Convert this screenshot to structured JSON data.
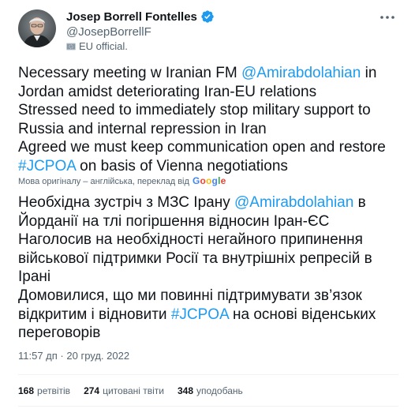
{
  "author": {
    "display_name": "Josep Borrell Fontelles",
    "handle": "@JosepBorrellF",
    "affiliation": "EU official."
  },
  "tweet": {
    "original_lines": [
      [
        {
          "t": "Necessary meeting w Iranian FM "
        },
        {
          "t": "@Amirabdolahian",
          "link": true
        },
        {
          "t": " in"
        }
      ],
      [
        {
          "t": "Jordan amidst deteriorating Iran-EU relations"
        }
      ],
      [
        {
          "t": "Stressed need to immediately stop military support to"
        }
      ],
      [
        {
          "t": "Russia and internal repression in Iran"
        }
      ],
      [
        {
          "t": "Agreed we must keep communication open and restore"
        }
      ],
      [
        {
          "t": "#JCPOA",
          "link": true
        },
        {
          "t": " on basis of Vienna negotiations"
        }
      ]
    ],
    "translated_note": "Мова оригіналу – англійська, переклад від",
    "translator": "Google",
    "translation_lines": [
      [
        {
          "t": "Необхідна зустріч з МЗС Ірану "
        },
        {
          "t": "@Amirabdolahian",
          "link": true
        },
        {
          "t": " в"
        }
      ],
      [
        {
          "t": "Йорданії на тлі погіршення відносин Іран-ЄС"
        }
      ],
      [
        {
          "t": "Наголосив на необхідності негайного припинення"
        }
      ],
      [
        {
          "t": "військової підтримки Росії та внутрішніх репресій в"
        }
      ],
      [
        {
          "t": "Ірані"
        }
      ],
      [
        {
          "t": "Домовилися, що ми повинні підтримувати зв’язок"
        }
      ],
      [
        {
          "t": "відкритим і відновити "
        },
        {
          "t": "#JCPOA",
          "link": true
        },
        {
          "t": " на основі віденських"
        }
      ],
      [
        {
          "t": "переговорів"
        }
      ]
    ]
  },
  "meta": {
    "time": "11:57 дп",
    "separator": " · ",
    "date": "20 груд. 2022"
  },
  "stats": {
    "retweets_count": "168",
    "retweets_label": "ретвітів",
    "quotes_count": "274",
    "quotes_label": "цитовані твіти",
    "likes_count": "348",
    "likes_label": "уподобань"
  },
  "colors": {
    "link": "#1d9bf0",
    "verified": "#1d9bf0",
    "text": "#0f1419",
    "secondary": "#536471"
  },
  "icons": {
    "verified": "verified-badge-icon",
    "affiliation": "eu-flag-icon",
    "more": "more-dots-icon"
  }
}
